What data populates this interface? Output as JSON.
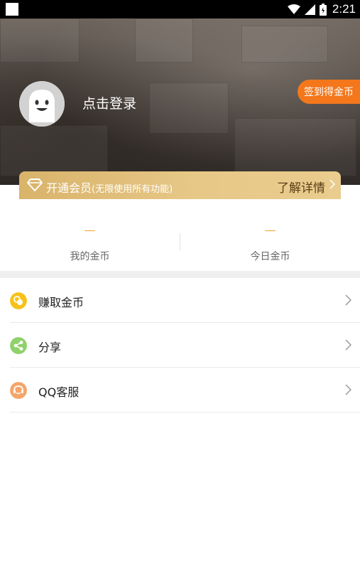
{
  "status_bar": {
    "time": "2:21"
  },
  "profile": {
    "login_prompt": "点击登录",
    "signin_button": "签到得金币"
  },
  "vip": {
    "title": "开通会员",
    "subtitle": "(无限使用所有功能)",
    "more_label": "了解详情"
  },
  "coins": {
    "mine": {
      "value": "—",
      "label": "我的金币"
    },
    "today": {
      "value": "—",
      "label": "今日金币"
    }
  },
  "menu": {
    "items": [
      {
        "label": "赚取金币",
        "icon": "coin-icon",
        "color": "#f6c21a"
      },
      {
        "label": "分享",
        "icon": "share-icon",
        "color": "#8fd16a"
      },
      {
        "label": "QQ客服",
        "icon": "customer-service-icon",
        "color": "#f5a56a"
      }
    ]
  },
  "colors": {
    "accent_orange": "#f4771c",
    "vip_gold": "#e3c07d",
    "coin_value": "#f1a73a"
  }
}
